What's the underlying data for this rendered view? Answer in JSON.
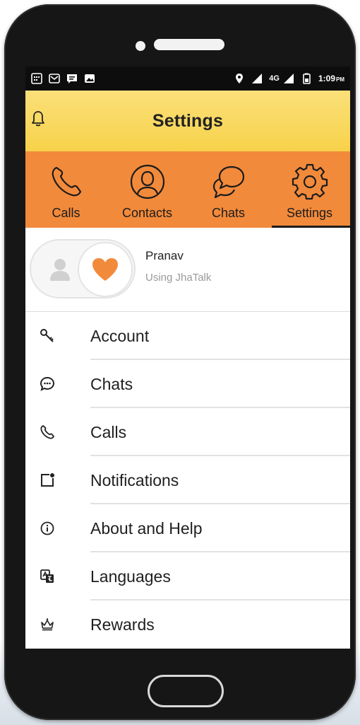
{
  "status_bar": {
    "time": "1:09",
    "ampm": "PM",
    "network": "4G",
    "left_icons": [
      "calendar-icon",
      "mail-icon",
      "message-icon",
      "image-icon"
    ],
    "right_icons": [
      "location-icon",
      "signal-icon",
      "signal-icon",
      "battery-icon"
    ]
  },
  "header": {
    "title": "Settings",
    "left_icon": "bell-icon"
  },
  "tabs": [
    {
      "label": "Calls",
      "icon": "phone-icon",
      "active": false
    },
    {
      "label": "Contacts",
      "icon": "contact-icon",
      "active": false
    },
    {
      "label": "Chats",
      "icon": "chat-icon",
      "active": false
    },
    {
      "label": "Settings",
      "icon": "gear-icon",
      "active": true
    }
  ],
  "profile": {
    "name": "Pranav",
    "status": "Using JhaTalk"
  },
  "menu": {
    "items": [
      {
        "label": "Account",
        "icon": "key-icon"
      },
      {
        "label": "Chats",
        "icon": "chat-bubble-icon"
      },
      {
        "label": "Calls",
        "icon": "phone-icon"
      },
      {
        "label": "Notifications",
        "icon": "notification-icon"
      },
      {
        "label": "About and Help",
        "icon": "info-icon"
      },
      {
        "label": "Languages",
        "icon": "translate-icon"
      },
      {
        "label": "Rewards",
        "icon": "crown-icon"
      }
    ]
  },
  "colors": {
    "header_top": "#fbe07a",
    "tabs_bg": "#f28a3b",
    "heart": "#f28a3b"
  }
}
